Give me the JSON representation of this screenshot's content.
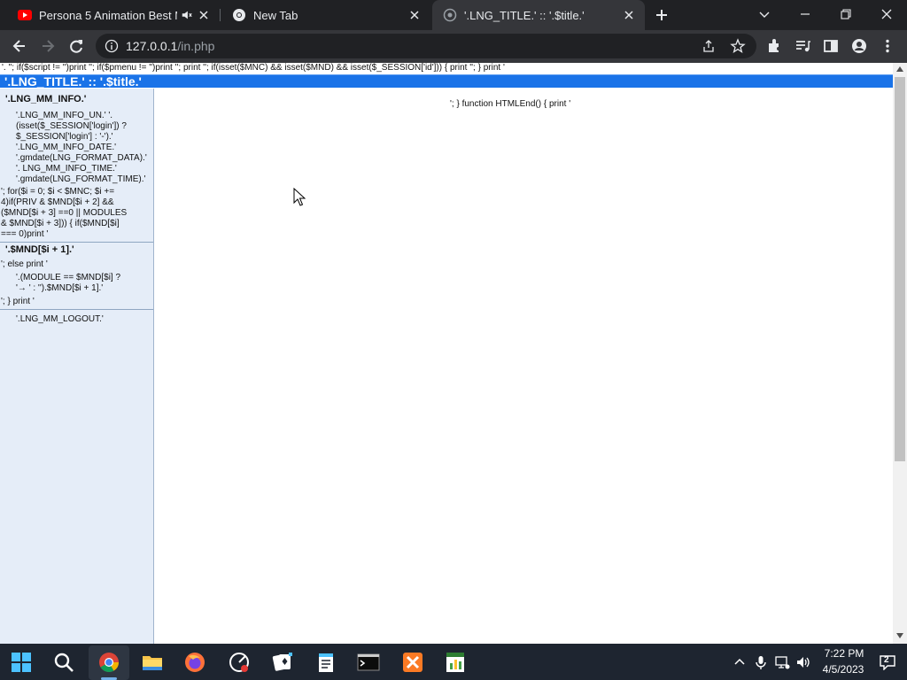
{
  "browser": {
    "tabs": [
      {
        "title": "Persona 5 Animation Best M",
        "favicon": "youtube-icon",
        "audio": "speaker-muted-icon"
      },
      {
        "title": "New Tab",
        "favicon": "chrome-icon"
      },
      {
        "title": "'.LNG_TITLE.' :: '.$title.'",
        "favicon": "globe-icon",
        "active": true
      }
    ],
    "url_host": "127.0.0.1",
    "url_path": "/in.php"
  },
  "page": {
    "top_code": "'. ''; if($script != '')print ''; if($pmenu != '')print ''; print ''; if(isset($MNC) && isset($MND) && isset($_SESSION['id'])) { print ''; } print '",
    "title_bar": "'.LNG_TITLE.' :: '.$title.'",
    "main_code": "'; } function HTMLEnd() { print '",
    "sidebar": {
      "info_heading": "'.LNG_MM_INFO.'",
      "info_lines": [
        "'.LNG_MM_INFO_UN.' '.",
        "(isset($_SESSION['login']) ?",
        "$_SESSION['login'] : '-').'",
        "'.LNG_MM_INFO_DATE.'",
        "'.gmdate(LNG_FORMAT_DATA).'",
        "'. LNG_MM_INFO_TIME.'",
        "'.gmdate(LNG_FORMAT_TIME).'"
      ],
      "loop_lines": [
        "'; for($i = 0; $i < $MNC; $i +=",
        "4)if(PRIV & $MND[$i + 2] &&",
        "($MND[$i + 3] ==0 || MODULES",
        "& $MND[$i + 3])) { if($MND[$i]",
        "=== 0)print '"
      ],
      "mnd_heading": "'.$MND[$i + 1].'",
      "else_line": "'; else print '",
      "module_lines": [
        "'.(MODULE == $MND[$i] ?",
        "'→ ' : '').$MND[$i + 1].'"
      ],
      "close_line": "'; } print '",
      "logout": "'.LNG_MM_LOGOUT.'"
    }
  },
  "taskbar": {
    "time": "7:22 PM",
    "date": "4/5/2023",
    "apps": [
      "windows-start-icon",
      "search-icon",
      "chrome-icon",
      "file-explorer-icon",
      "firefox-icon",
      "app-icon",
      "solitaire-icon",
      "notepad-icon",
      "terminal-icon",
      "xampp-icon",
      "spreadsheet-icon"
    ],
    "tray": [
      "chevron-up-icon",
      "microphone-icon",
      "network-icon",
      "volume-icon",
      "notification-icon"
    ],
    "notification_count": "2"
  },
  "colors": {
    "title_bar": "#1a73e8",
    "sidebar_bg": "#e5edf8",
    "chrome_dark": "#202124",
    "chrome_toolbar": "#35363a",
    "taskbar": "#1e2530"
  }
}
